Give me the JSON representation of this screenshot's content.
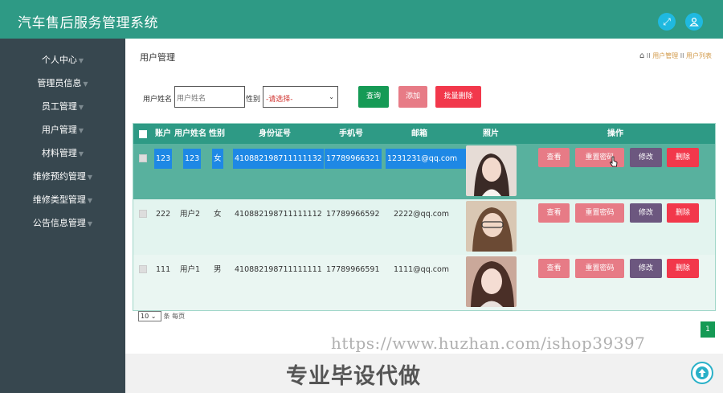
{
  "app": {
    "title": "汽车售后服务管理系统"
  },
  "header": {
    "fullscreen_icon": "expand-icon",
    "user_icon": "user-icon"
  },
  "sidebar": {
    "items": [
      {
        "label": "个人中心"
      },
      {
        "label": "管理员信息"
      },
      {
        "label": "员工管理"
      },
      {
        "label": "用户管理"
      },
      {
        "label": "材料管理"
      },
      {
        "label": "维修预约管理"
      },
      {
        "label": "维修类型管理"
      },
      {
        "label": "公告信息管理"
      }
    ]
  },
  "page": {
    "title": "用户管理",
    "breadcrumb": [
      "用户管理",
      "用户列表"
    ],
    "breadcrumb_sep": "II"
  },
  "filters": {
    "name_label": "用户姓名",
    "name_placeholder": "用户姓名",
    "gender_label": "性别",
    "gender_value": "-请选择-"
  },
  "actions": {
    "query": "查询",
    "add": "添加",
    "batch_delete": "批量删除"
  },
  "table": {
    "columns": [
      "账户",
      "用户姓名",
      "性别",
      "身份证号",
      "手机号",
      "邮箱",
      "照片",
      "操作"
    ],
    "rows": [
      {
        "account": "123",
        "name": "123",
        "gender": "女",
        "id_card": "410882198711111132",
        "phone": "17789966321",
        "email": "1231231@qq.com",
        "selected": true
      },
      {
        "account": "222",
        "name": "用户2",
        "gender": "女",
        "id_card": "410882198711111112",
        "phone": "17789966592",
        "email": "2222@qq.com",
        "selected": false
      },
      {
        "account": "111",
        "name": "用户1",
        "gender": "男",
        "id_card": "410882198711111111",
        "phone": "17789966591",
        "email": "1111@qq.com",
        "selected": false
      }
    ],
    "row_actions": {
      "view": "查看",
      "reset": "重置密码",
      "edit": "修改",
      "delete": "删除"
    }
  },
  "pagination": {
    "page_size": "10",
    "per_page_label": "条 每页",
    "current_page": "1"
  },
  "watermark": "https://www.huzhan.com/ishop39397",
  "promo": "专业毕设代做",
  "colors": {
    "primary": "#2e9a85",
    "sidebar": "#37474f",
    "query": "#159a55",
    "add": "#e77b86",
    "delete": "#f2384b",
    "edit": "#6c577f",
    "selected_row": "#58b19e",
    "highlight": "#1e88e5"
  }
}
